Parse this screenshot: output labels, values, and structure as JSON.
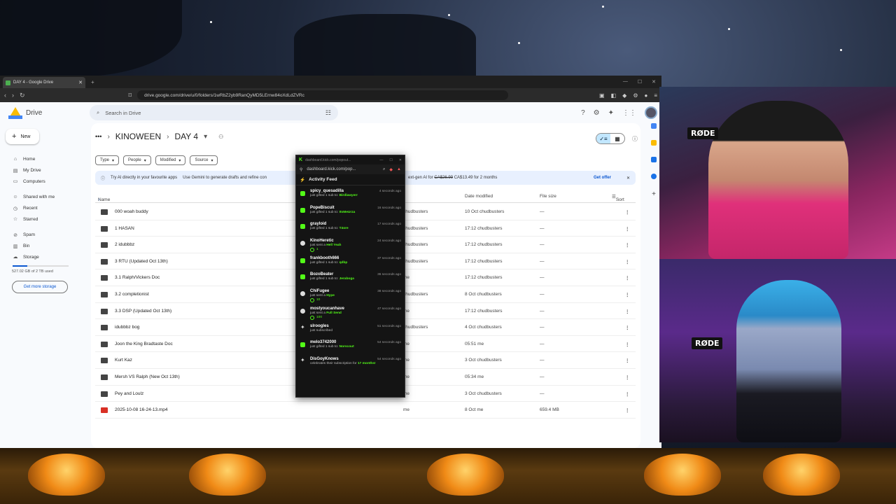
{
  "browser": {
    "tab_title": "DAY 4 - Google Drive",
    "url": "drive.google.com/drive/u/0/folders/1wRbZ2yb9RanQyMD5LErnw84oXdLdZVRc"
  },
  "drive": {
    "brand": "Drive",
    "search_placeholder": "Search in Drive",
    "new_label": "New",
    "nav": [
      {
        "label": "Home",
        "icon": "home-icon"
      },
      {
        "label": "My Drive",
        "icon": "my-drive-icon"
      },
      {
        "label": "Computers",
        "icon": "computer-icon"
      },
      {
        "label": "Shared with me",
        "icon": "people-icon"
      },
      {
        "label": "Recent",
        "icon": "clock-icon"
      },
      {
        "label": "Starred",
        "icon": "star-icon"
      },
      {
        "label": "Spam",
        "icon": "spam-icon"
      },
      {
        "label": "Bin",
        "icon": "trash-icon"
      },
      {
        "label": "Storage",
        "icon": "cloud-icon"
      }
    ],
    "storage_text": "527.02 GB of 2 TB used",
    "storage_fraction": 0.26,
    "get_storage": "Get more storage",
    "breadcrumb": [
      "KINOWEEN",
      "DAY 4"
    ],
    "filters": [
      "Type",
      "People",
      "Modified",
      "Source"
    ],
    "banner": {
      "left": "Try AI directly in your favourite apps",
      "left_rest": "Use Gemini to generate drafts and refine con",
      "right_prefix": "ext-gen AI for",
      "old_price": "CA$26.99",
      "right_suffix": "CA$13.49 for 2 months",
      "cta": "Get offer"
    },
    "columns": {
      "name": "Name",
      "modified": "Date modified",
      "size": "File size",
      "sort": "Sort"
    },
    "files": [
      {
        "name": "000 woah buddy",
        "owner": "chudbusters",
        "modified": "10 Oct chudbusters",
        "size": "—",
        "type": "folder"
      },
      {
        "name": "1 HASAN",
        "owner": "chudbusters",
        "modified": "17:12 chudbusters",
        "size": "—",
        "type": "folder"
      },
      {
        "name": "2 idubbbz",
        "owner": "chudbusters",
        "modified": "17:12 chudbusters",
        "size": "—",
        "type": "folder"
      },
      {
        "name": "3 RTU (Updated Oct 13th)",
        "owner": "chudbusters",
        "modified": "17:12 chudbusters",
        "size": "—",
        "type": "folder"
      },
      {
        "name": "3.1 Ralph/Vickers Doc",
        "owner": "me",
        "modified": "17:12 chudbusters",
        "size": "—",
        "type": "folder"
      },
      {
        "name": "3.2 completionist",
        "owner": "chudbusters",
        "modified": "8 Oct chudbusters",
        "size": "—",
        "type": "folder"
      },
      {
        "name": "3.3 DSP (Updated Oct 13th)",
        "owner": "me",
        "modified": "17:12 chudbusters",
        "size": "—",
        "type": "folder"
      },
      {
        "name": "idubbbz bog",
        "owner": "chudbusters",
        "modified": "4 Oct chudbusters",
        "size": "—",
        "type": "folder"
      },
      {
        "name": "Joon the King Bradtaste Doc",
        "owner": "me",
        "modified": "05:51 me",
        "size": "—",
        "type": "folder"
      },
      {
        "name": "Kurt Kaz",
        "owner": "me",
        "modified": "3 Oct chudbusters",
        "size": "—",
        "type": "folder"
      },
      {
        "name": "Mersh VS Ralph (New Oct 13th)",
        "owner": "me",
        "modified": "05:34 me",
        "size": "—",
        "type": "folder"
      },
      {
        "name": "Pey and Loulz",
        "owner": "me",
        "modified": "3 Oct chudbusters",
        "size": "—",
        "type": "folder"
      },
      {
        "name": "2025-10-08 16-24-13.mp4",
        "owner": "me",
        "modified": "8 Oct me",
        "size": "659.4 MB",
        "type": "video"
      }
    ]
  },
  "kick": {
    "title_url": "dashboard.kick.com/popout...",
    "url": "dashboard.kick.com/pop...",
    "feed_title": "Activity Feed",
    "events": [
      {
        "user": "spicy_quesadilla",
        "time": "4 seconds ago",
        "text": "just gifted 1 sub to:",
        "target": "Birdlawyerr",
        "kind": "sub"
      },
      {
        "user": "PopeBiscuit",
        "time": "16 seconds ago",
        "text": "just gifted 1 sub to:",
        "target": "ItsMeUrza",
        "kind": "sub"
      },
      {
        "user": "grayloid",
        "time": "17 seconds ago",
        "text": "just gifted 1 sub to:",
        "target": "T4ore",
        "kind": "sub"
      },
      {
        "user": "KinoHeretic",
        "time": "24 seconds ago",
        "text": "just sent a",
        "target": "Hell Yeah",
        "amount": "1",
        "kind": "kicks"
      },
      {
        "user": "frankbooth666",
        "time": "37 seconds ago",
        "text": "just gifted 1 sub to:",
        "target": "qdbp",
        "kind": "sub"
      },
      {
        "user": "BozoBeater",
        "time": "36 seconds ago",
        "text": "just gifted 1 sub to:",
        "target": "Jeraboga",
        "kind": "sub"
      },
      {
        "user": "ChiFugee",
        "time": "38 seconds ago",
        "text": "just sent a",
        "target": "Hype",
        "amount": "10",
        "kind": "kicks"
      },
      {
        "user": "mostyoucanhave",
        "time": "47 seconds ago",
        "text": "just sent a",
        "target": "Full Send",
        "amount": "100",
        "kind": "kicks"
      },
      {
        "user": "slroogles",
        "time": "51 seconds ago",
        "text": "just subscribed",
        "target": "",
        "kind": "star"
      },
      {
        "user": "melo3742000",
        "time": "54 seconds ago",
        "text": "just gifted 1 sub to:",
        "target": "Norscout",
        "kind": "sub"
      },
      {
        "user": "DisGoyKnows",
        "time": "54 seconds ago",
        "text": "celebrates their subscription for",
        "target": "17 months!",
        "kind": "star"
      }
    ]
  },
  "overlay": {
    "mic_brand": "RØDE"
  },
  "colors": {
    "kick_green": "#53fc18",
    "drive_blue": "#0b57d0"
  }
}
